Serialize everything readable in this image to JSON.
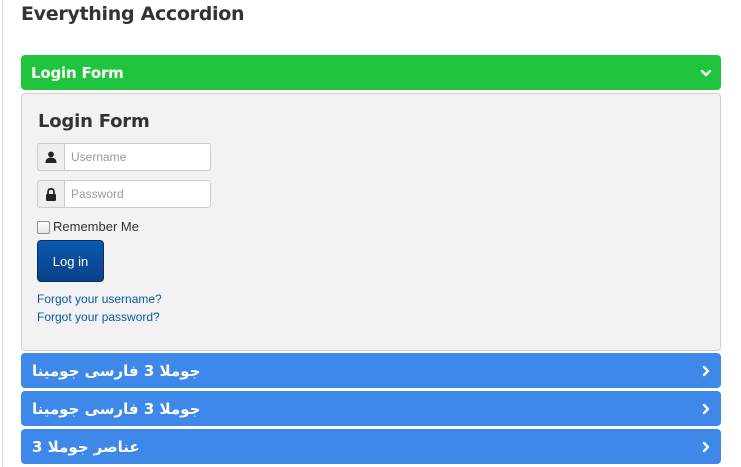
{
  "module": {
    "title": "Everything Accordion"
  },
  "accordion": {
    "colors": {
      "active": "#20c53d",
      "inactive": "#3d88e8",
      "button": "#0b3f88",
      "link": "#0d58a6"
    },
    "items": [
      {
        "label": "Login Form",
        "expanded": true,
        "icon": "chevron-down-icon"
      },
      {
        "label": "جوملا 3 فارسی جومینا",
        "expanded": false,
        "icon": "chevron-right-icon"
      },
      {
        "label": "جوملا 3 فارسی جومینا",
        "expanded": false,
        "icon": "chevron-right-icon"
      },
      {
        "label": "عناصر جوملا 3",
        "expanded": false,
        "icon": "chevron-right-icon"
      }
    ]
  },
  "login": {
    "title": "Login Form",
    "username": {
      "placeholder": "Username",
      "value": "",
      "icon": "user-icon"
    },
    "password": {
      "placeholder": "Password",
      "value": "",
      "icon": "lock-icon"
    },
    "remember_label": "Remember Me",
    "remember_checked": false,
    "submit_label": "Log in",
    "forgot_username": "Forgot your username?",
    "forgot_password": "Forgot your password?"
  }
}
